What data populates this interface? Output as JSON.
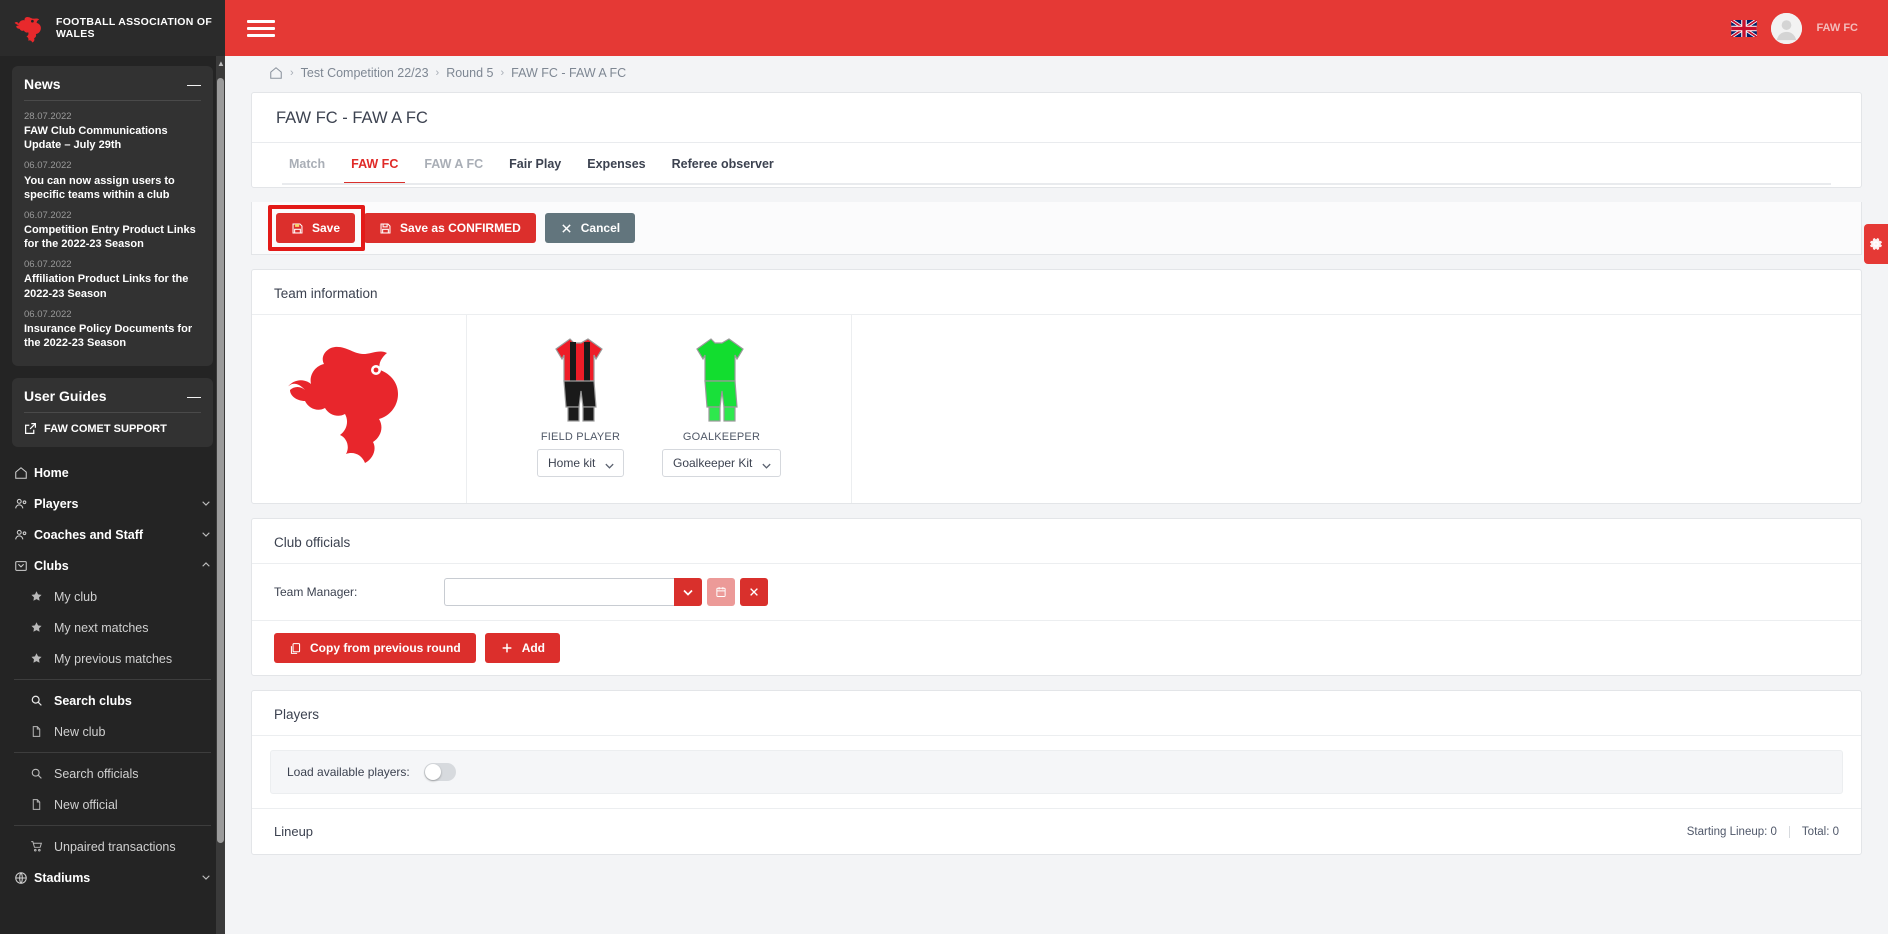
{
  "brand": {
    "name": "FOOTBALL ASSOCIATION OF WALES",
    "crest_icon": "welsh-dragon-icon"
  },
  "topbar": {
    "menu_icon": "hamburger-icon",
    "flag_icon": "union-jack-flag-icon",
    "avatar_icon": "user-avatar-icon",
    "user_name": "FAW FC"
  },
  "sidebar": {
    "news": {
      "title": "News",
      "collapse_label": "—",
      "items": [
        {
          "date": "28.07.2022",
          "title": "FAW Club Communications Update – July 29th"
        },
        {
          "date": "06.07.2022",
          "title": "You can now assign users to specific teams within a club"
        },
        {
          "date": "06.07.2022",
          "title": "Competition Entry Product Links for the 2022-23 Season"
        },
        {
          "date": "06.07.2022",
          "title": "Affiliation Product Links for the 2022-23 Season"
        },
        {
          "date": "06.07.2022",
          "title": "Insurance Policy Documents for the 2022-23 Season"
        }
      ]
    },
    "user_guides": {
      "title": "User Guides",
      "collapse_label": "—",
      "link_label": "FAW COMET SUPPORT",
      "link_icon": "external-link-icon"
    },
    "nav": [
      {
        "label": "Home",
        "icon": "home-icon",
        "level": "top",
        "bold": true,
        "chevron": ""
      },
      {
        "label": "Players",
        "icon": "people-icon",
        "level": "top",
        "bold": true,
        "chevron": "⌄"
      },
      {
        "label": "Coaches and Staff",
        "icon": "people-icon",
        "level": "top",
        "bold": true,
        "chevron": "⌄"
      },
      {
        "label": "Clubs",
        "icon": "clubs-icon",
        "level": "top",
        "bold": true,
        "chevron": "⌃"
      },
      {
        "label": "My club",
        "icon": "star-icon",
        "level": "sub",
        "bold": false,
        "chevron": ""
      },
      {
        "label": "My next matches",
        "icon": "star-icon",
        "level": "sub",
        "bold": false,
        "chevron": ""
      },
      {
        "label": "My previous matches",
        "icon": "star-icon",
        "level": "sub",
        "bold": false,
        "chevron": ""
      },
      {
        "label": "Search clubs",
        "icon": "search-icon",
        "level": "sub-sep",
        "bold": true,
        "chevron": ""
      },
      {
        "label": "New club",
        "icon": "document-icon",
        "level": "sub",
        "bold": false,
        "chevron": ""
      },
      {
        "label": "Search officials",
        "icon": "search-icon",
        "level": "sub-sep",
        "bold": false,
        "chevron": ""
      },
      {
        "label": "New official",
        "icon": "document-icon",
        "level": "sub",
        "bold": false,
        "chevron": ""
      },
      {
        "label": "Unpaired transactions",
        "icon": "cart-icon",
        "level": "sub-sep",
        "bold": false,
        "chevron": ""
      },
      {
        "label": "Stadiums",
        "icon": "globe-icon",
        "level": "top",
        "bold": true,
        "chevron": "⌄"
      }
    ]
  },
  "breadcrumb": {
    "home_icon": "home-icon",
    "items": [
      "Test Competition 22/23",
      "Round 5",
      "FAW FC - FAW A FC"
    ],
    "separator": "›"
  },
  "page": {
    "title": "FAW FC - FAW A FC",
    "tabs": [
      {
        "label": "Match",
        "state": "muted"
      },
      {
        "label": "FAW FC",
        "state": "active"
      },
      {
        "label": "FAW A FC",
        "state": "muted"
      },
      {
        "label": "Fair Play",
        "state": "normal"
      },
      {
        "label": "Expenses",
        "state": "normal"
      },
      {
        "label": "Referee observer",
        "state": "normal"
      }
    ]
  },
  "actions": {
    "save": {
      "label": "Save",
      "icon": "save-disk-icon",
      "highlighted": true
    },
    "save_confirmed": {
      "label": "Save as CONFIRMED",
      "icon": "save-disk-icon"
    },
    "cancel": {
      "label": "Cancel",
      "icon": "close-x-icon"
    }
  },
  "team_information": {
    "title": "Team information",
    "crest_icon": "welsh-dragon-crest-icon",
    "kits": [
      {
        "label": "FIELD PLAYER",
        "selected": "Home kit",
        "icon": "field-player-kit-icon",
        "shirt_color": "#ee1c27",
        "stripe_color": "#1a1a1a",
        "shorts_color": "#1a1a1a"
      },
      {
        "label": "GOALKEEPER",
        "selected": "Goalkeeper Kit",
        "icon": "goalkeeper-kit-icon",
        "shirt_color": "#12dd2f",
        "stripe_color": "#12dd2f",
        "shorts_color": "#19e03a"
      }
    ]
  },
  "club_officials": {
    "title": "Club officials",
    "team_manager_label": "Team Manager:",
    "team_manager_value": "",
    "team_manager_placeholder": "",
    "dropdown_icon": "chevron-down-icon",
    "calendar_icon": "calendar-icon",
    "clear_icon": "close-x-icon",
    "copy_button": {
      "label": "Copy from previous round",
      "icon": "copy-icon"
    },
    "add_button": {
      "label": "Add",
      "icon": "plus-icon"
    }
  },
  "players": {
    "title": "Players",
    "load_available_label": "Load available players:",
    "load_available_on": false,
    "lineup_title": "Lineup",
    "starting_lineup_count": "Starting Lineup: 0",
    "total_count": "Total: 0"
  },
  "settings_tab": {
    "icon": "gear-icon"
  },
  "colors": {
    "brand_red": "#e53935",
    "button_red": "#dc2f2c",
    "accent_red": "#e02a27",
    "sidebar_bg": "#242424",
    "gray_button": "#62757d"
  }
}
